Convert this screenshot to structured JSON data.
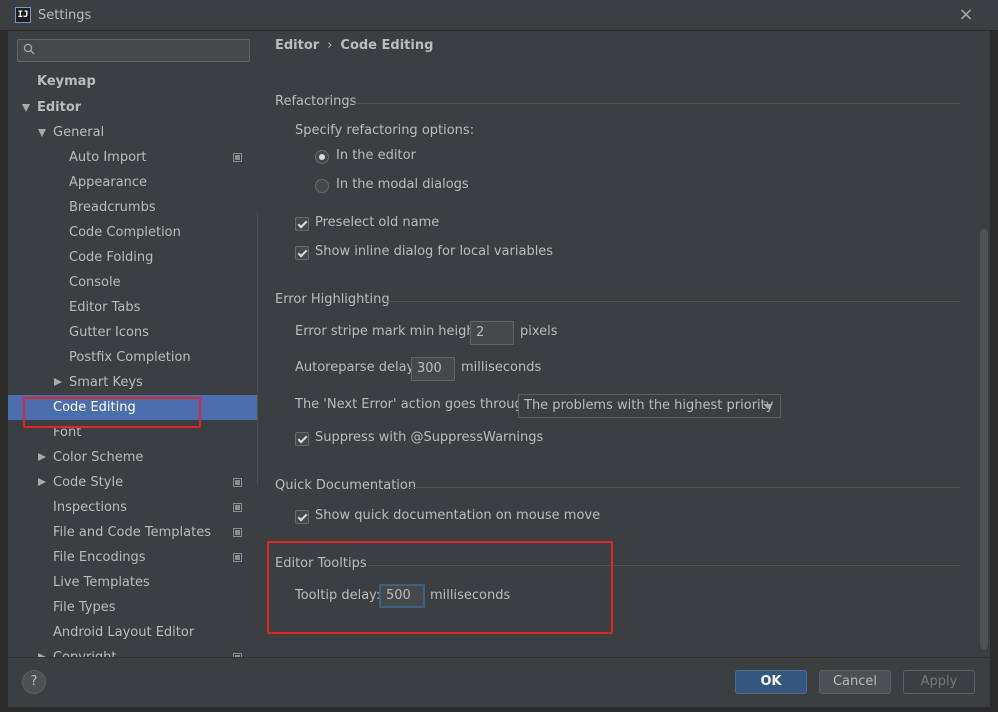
{
  "window": {
    "icon_text": "IJ",
    "title": "Settings",
    "close_glyph": "×"
  },
  "sidebar": {
    "search": {
      "value": "",
      "placeholder": ""
    },
    "items": [
      {
        "label": "Keymap",
        "level": 0,
        "bold": true
      },
      {
        "label": "Editor",
        "level": 0,
        "bold": true,
        "expanded": true
      },
      {
        "label": "General",
        "level": 1,
        "expanded": true
      },
      {
        "label": "Auto Import",
        "level": 2,
        "icon": "copy-icon"
      },
      {
        "label": "Appearance",
        "level": 2
      },
      {
        "label": "Breadcrumbs",
        "level": 2
      },
      {
        "label": "Code Completion",
        "level": 2
      },
      {
        "label": "Code Folding",
        "level": 2
      },
      {
        "label": "Console",
        "level": 2
      },
      {
        "label": "Editor Tabs",
        "level": 2
      },
      {
        "label": "Gutter Icons",
        "level": 2
      },
      {
        "label": "Postfix Completion",
        "level": 2
      },
      {
        "label": "Smart Keys",
        "level": 2,
        "collapsed": true
      },
      {
        "label": "Code Editing",
        "level": 1,
        "selected": true
      },
      {
        "label": "Font",
        "level": 1
      },
      {
        "label": "Color Scheme",
        "level": 1,
        "collapsed": true
      },
      {
        "label": "Code Style",
        "level": 1,
        "collapsed": true,
        "icon": "copy-icon"
      },
      {
        "label": "Inspections",
        "level": 1,
        "icon": "copy-icon"
      },
      {
        "label": "File and Code Templates",
        "level": 1,
        "icon": "copy-icon"
      },
      {
        "label": "File Encodings",
        "level": 1,
        "icon": "copy-icon"
      },
      {
        "label": "Live Templates",
        "level": 1
      },
      {
        "label": "File Types",
        "level": 1
      },
      {
        "label": "Android Layout Editor",
        "level": 1
      },
      {
        "label": "Copyright",
        "level": 1,
        "collapsed": true,
        "icon": "copy-icon"
      }
    ]
  },
  "breadcrumb": {
    "parent": "Editor",
    "separator": "›",
    "current": "Code Editing"
  },
  "refactorings": {
    "title": "Refactorings",
    "specify_label": "Specify refactoring options:",
    "options": [
      {
        "label": "In the editor",
        "checked": true
      },
      {
        "label": "In the modal dialogs",
        "checked": false
      }
    ],
    "preselect_label": "Preselect old name",
    "inline_dialog_label": "Show inline dialog for local variables"
  },
  "error_highlighting": {
    "title": "Error Highlighting",
    "stripe_label": "Error stripe mark min height:",
    "stripe_value": "2",
    "stripe_unit": "pixels",
    "autoreparse_label": "Autoreparse delay:",
    "autoreparse_value": "300",
    "autoreparse_unit": "milliseconds",
    "next_error_label": "The 'Next Error' action goes through:",
    "next_error_value": "The problems with the highest priority",
    "suppress_label": "Suppress with @SuppressWarnings"
  },
  "quick_documentation": {
    "title": "Quick Documentation",
    "show_label": "Show quick documentation on mouse move"
  },
  "editor_tooltips": {
    "title": "Editor Tooltips",
    "delay_label": "Tooltip delay:",
    "delay_value": "500",
    "delay_unit": "milliseconds"
  },
  "footer": {
    "help_label": "?",
    "ok_label": "OK",
    "cancel_label": "Cancel",
    "apply_label": "Apply"
  },
  "colors": {
    "background": "#3c3f41",
    "selection": "#4b6eaf",
    "annotation_red": "#e0262b",
    "primary_button": "#365880"
  }
}
